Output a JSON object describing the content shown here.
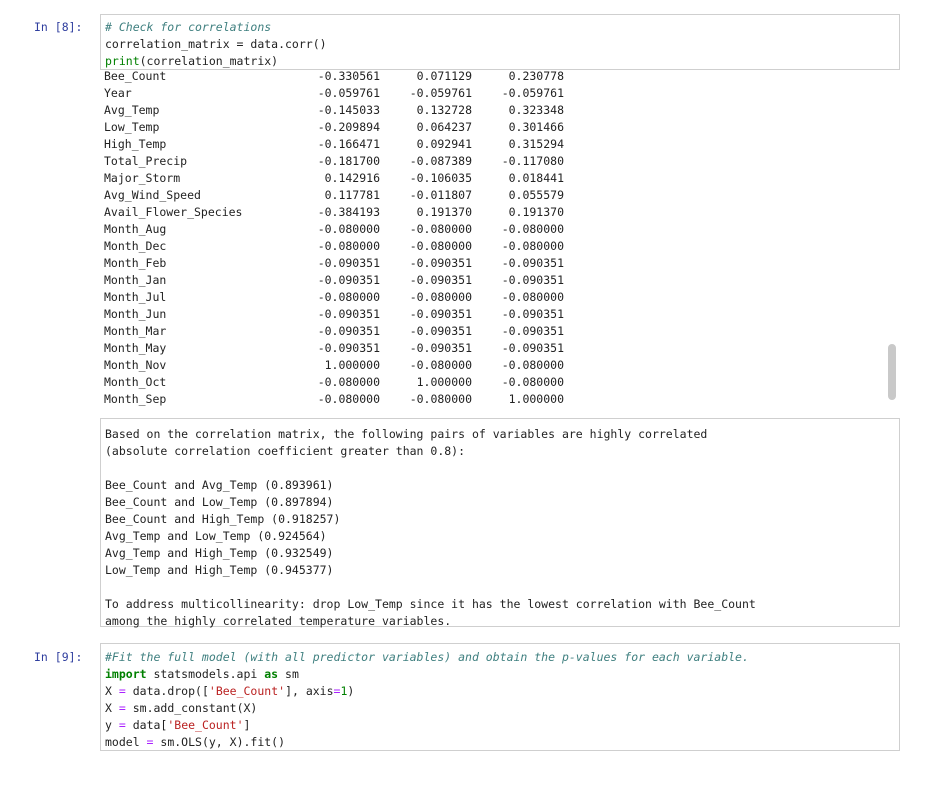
{
  "cell8": {
    "prompt": "In [8]:",
    "code": {
      "comment": "# Check for correlations",
      "line2": "correlation_matrix = data.corr()",
      "print_kw": "print",
      "print_arg": "(correlation_matrix)"
    },
    "output_rows": [
      {
        "name": "Bee_Count",
        "c1": "-0.330561",
        "c2": "0.071129",
        "c3": "0.230778"
      },
      {
        "name": "Year",
        "c1": "-0.059761",
        "c2": "-0.059761",
        "c3": "-0.059761"
      },
      {
        "name": "Avg_Temp",
        "c1": "-0.145033",
        "c2": "0.132728",
        "c3": "0.323348"
      },
      {
        "name": "Low_Temp",
        "c1": "-0.209894",
        "c2": "0.064237",
        "c3": "0.301466"
      },
      {
        "name": "High_Temp",
        "c1": "-0.166471",
        "c2": "0.092941",
        "c3": "0.315294"
      },
      {
        "name": "Total_Precip",
        "c1": "-0.181700",
        "c2": "-0.087389",
        "c3": "-0.117080"
      },
      {
        "name": "Major_Storm",
        "c1": "0.142916",
        "c2": "-0.106035",
        "c3": "0.018441"
      },
      {
        "name": "Avg_Wind_Speed",
        "c1": "0.117781",
        "c2": "-0.011807",
        "c3": "0.055579"
      },
      {
        "name": "Avail_Flower_Species",
        "c1": "-0.384193",
        "c2": "0.191370",
        "c3": "0.191370"
      },
      {
        "name": "Month_Aug",
        "c1": "-0.080000",
        "c2": "-0.080000",
        "c3": "-0.080000"
      },
      {
        "name": "Month_Dec",
        "c1": "-0.080000",
        "c2": "-0.080000",
        "c3": "-0.080000"
      },
      {
        "name": "Month_Feb",
        "c1": "-0.090351",
        "c2": "-0.090351",
        "c3": "-0.090351"
      },
      {
        "name": "Month_Jan",
        "c1": "-0.090351",
        "c2": "-0.090351",
        "c3": "-0.090351"
      },
      {
        "name": "Month_Jul",
        "c1": "-0.080000",
        "c2": "-0.080000",
        "c3": "-0.080000"
      },
      {
        "name": "Month_Jun",
        "c1": "-0.090351",
        "c2": "-0.090351",
        "c3": "-0.090351"
      },
      {
        "name": "Month_Mar",
        "c1": "-0.090351",
        "c2": "-0.090351",
        "c3": "-0.090351"
      },
      {
        "name": "Month_May",
        "c1": "-0.090351",
        "c2": "-0.090351",
        "c3": "-0.090351"
      },
      {
        "name": "Month_Nov",
        "c1": "1.000000",
        "c2": "-0.080000",
        "c3": "-0.080000"
      },
      {
        "name": "Month_Oct",
        "c1": "-0.080000",
        "c2": "1.000000",
        "c3": "-0.080000"
      },
      {
        "name": "Month_Sep",
        "c1": "-0.080000",
        "c2": "-0.080000",
        "c3": "1.000000"
      }
    ]
  },
  "markdown": {
    "intro1": "Based on the correlation matrix, the following pairs of variables are highly correlated",
    "intro2": "(absolute correlation coefficient greater than 0.8):",
    "pairs": [
      "Bee_Count and Avg_Temp (0.893961)",
      "Bee_Count and Low_Temp (0.897894)",
      "Bee_Count and High_Temp (0.918257)",
      "Avg_Temp and Low_Temp (0.924564)",
      "Avg_Temp and High_Temp (0.932549)",
      "Low_Temp and High_Temp (0.945377)"
    ],
    "outro1": "To address multicollinearity: drop Low_Temp since it has the lowest correlation with Bee_Count",
    "outro2": "among the highly correlated temperature variables."
  },
  "cell9": {
    "prompt": "In [9]:",
    "comment": "#Fit the full model (with all predictor variables) and obtain the p-values for each variable.",
    "l2_kw1": "import",
    "l2_mod": " statsmodels.api ",
    "l2_kw2": "as",
    "l2_alias": " sm",
    "l3_a": "X ",
    "l3_eq": "=",
    "l3_b": " data.drop([",
    "l3_str": "'Bee_Count'",
    "l3_c": "], axis",
    "l3_eq2": "=",
    "l3_num": "1",
    "l3_d": ")",
    "l4_a": "X ",
    "l4_eq": "=",
    "l4_b": " sm.add_constant(X)",
    "l5_a": "y ",
    "l5_eq": "=",
    "l5_b": " data[",
    "l5_str": "'Bee_Count'",
    "l5_c": "]",
    "l6_a": "model ",
    "l6_eq": "=",
    "l6_b": " sm.OLS(y, X).fit()"
  }
}
